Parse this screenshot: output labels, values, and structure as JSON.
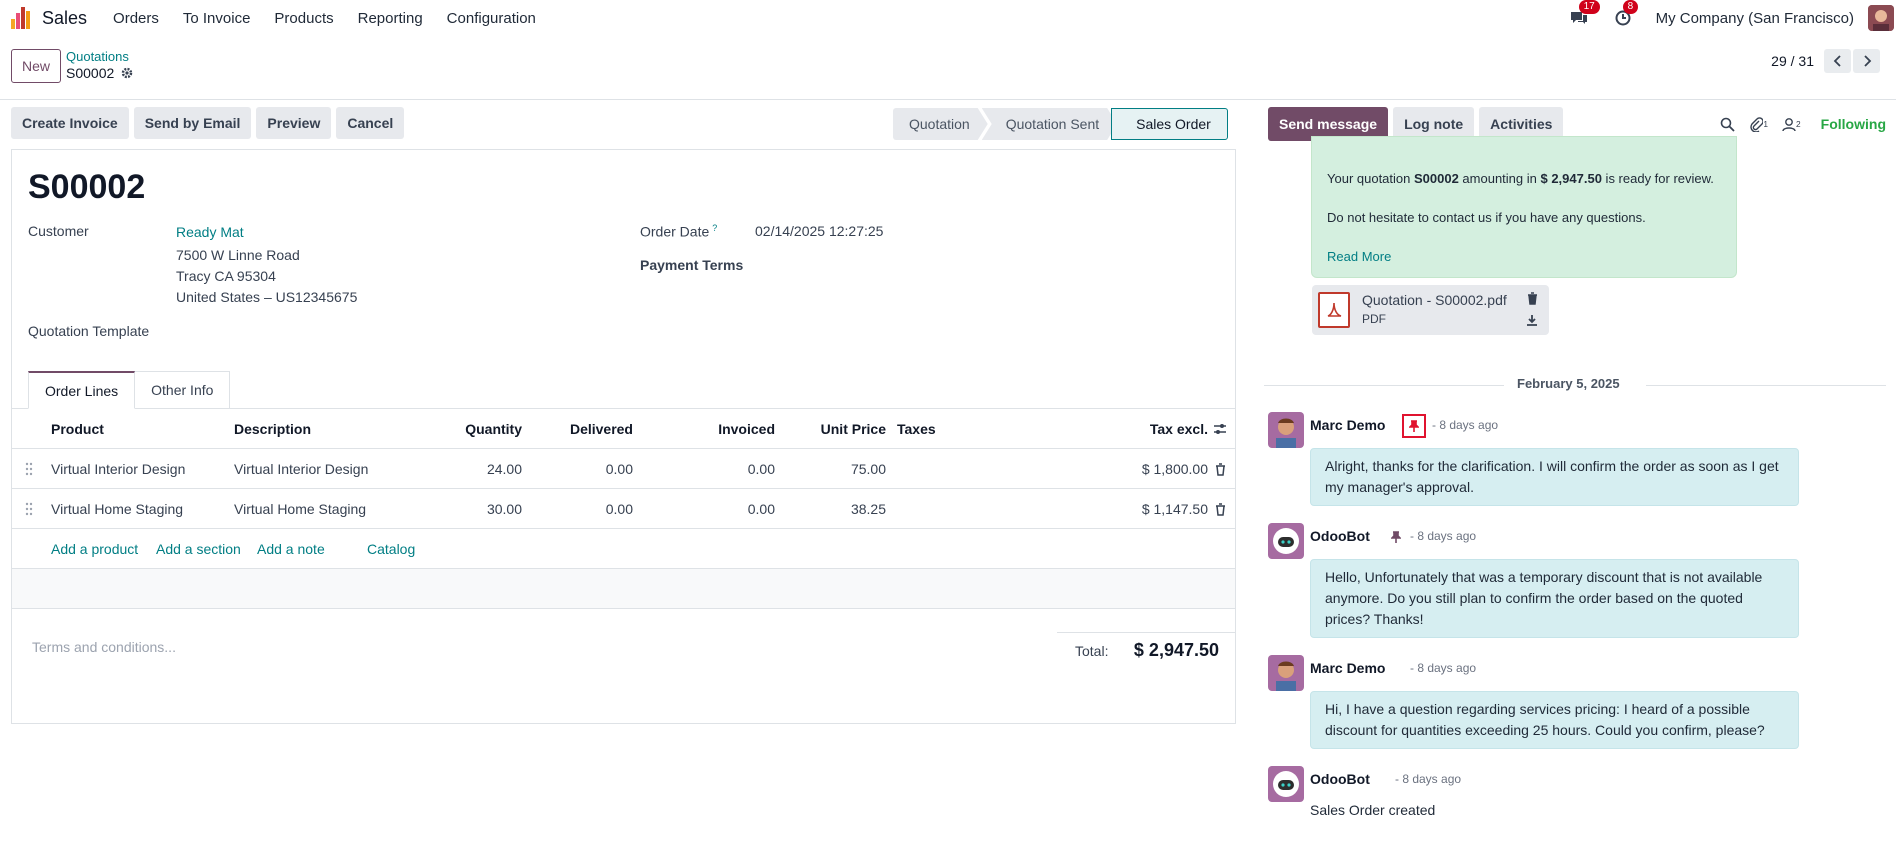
{
  "navbar": {
    "app_name": "Sales",
    "menu": [
      "Orders",
      "To Invoice",
      "Products",
      "Reporting",
      "Configuration"
    ],
    "messages_badge": "17",
    "activities_badge": "8",
    "company": "My Company (San Francisco)"
  },
  "control": {
    "new_label": "New",
    "breadcrumb_parent": "Quotations",
    "breadcrumb_current": "S00002",
    "pager": "29 / 31"
  },
  "actions": [
    "Create Invoice",
    "Send by Email",
    "Preview",
    "Cancel"
  ],
  "statusbar": {
    "stages": [
      "Quotation",
      "Quotation Sent",
      "Sales Order"
    ],
    "active": "Sales Order"
  },
  "form": {
    "title": "S00002",
    "customer_label": "Customer",
    "customer_name": "Ready Mat",
    "address_line1": "7500 W Linne Road",
    "address_line2": "Tracy CA 95304",
    "address_line3": "United States – US12345675",
    "template_label": "Quotation Template",
    "order_date_label": "Order Date",
    "order_date_help": "?",
    "order_date_value": "02/14/2025 12:27:25",
    "payment_terms_label": "Payment Terms"
  },
  "tabs": [
    "Order Lines",
    "Other Info"
  ],
  "order_lines": {
    "headers": {
      "product": "Product",
      "description": "Description",
      "quantity": "Quantity",
      "delivered": "Delivered",
      "invoiced": "Invoiced",
      "unit_price": "Unit Price",
      "taxes": "Taxes",
      "subtotal": "Tax excl."
    },
    "rows": [
      {
        "product": "Virtual Interior Design",
        "description": "Virtual Interior Design",
        "quantity": "24.00",
        "delivered": "0.00",
        "invoiced": "0.00",
        "unit_price": "75.00",
        "subtotal": "$ 1,800.00"
      },
      {
        "product": "Virtual Home Staging",
        "description": "Virtual Home Staging",
        "quantity": "30.00",
        "delivered": "0.00",
        "invoiced": "0.00",
        "unit_price": "38.25",
        "subtotal": "$ 1,147.50"
      }
    ],
    "add_links": [
      "Add a product",
      "Add a section",
      "Add a note",
      "Catalog"
    ]
  },
  "terms_placeholder": "Terms and conditions...",
  "total": {
    "label": "Total:",
    "value": "$ 2,947.50"
  },
  "chatter": {
    "buttons": {
      "send_message": "Send message",
      "log_note": "Log note",
      "activities": "Activities"
    },
    "attachments_count": "1",
    "followers_count": "2",
    "following": "Following",
    "email_preview": {
      "line1_prefix": "Your quotation ",
      "line1_ref": "S00002",
      "line1_mid": " amounting in ",
      "line1_amount": "$ 2,947.50",
      "line1_suffix": " is ready for review.",
      "line2": "Do not hesitate to contact us if you have any questions.",
      "read_more": "Read More"
    },
    "attachment": {
      "name": "Quotation - S00002.pdf",
      "type": "PDF"
    },
    "date_separator": "February 5, 2025",
    "messages": [
      {
        "author": "Marc Demo",
        "date": "- 8 days ago",
        "body": "Alright, thanks for the clarification. I will confirm the order as soon as I get my manager's approval."
      },
      {
        "author": "OdooBot",
        "date": "- 8 days ago",
        "body": "Hello, Unfortunately that was a temporary discount that is not available anymore. Do you still plan to confirm the order based on the quoted prices? Thanks!"
      },
      {
        "author": "Marc Demo",
        "date": "- 8 days ago",
        "body": "Hi, I have a question regarding services pricing: I heard of a possible discount for quantities exceeding 25 hours. Could you confirm, please?"
      },
      {
        "author": "OdooBot",
        "date": "- 8 days ago",
        "body": "Sales Order created"
      }
    ]
  },
  "colors": {
    "primary": "#714b67",
    "link": "#017e84",
    "badge": "#d0021b",
    "following": "#28a745",
    "pin_highlight": "#e0132f"
  }
}
